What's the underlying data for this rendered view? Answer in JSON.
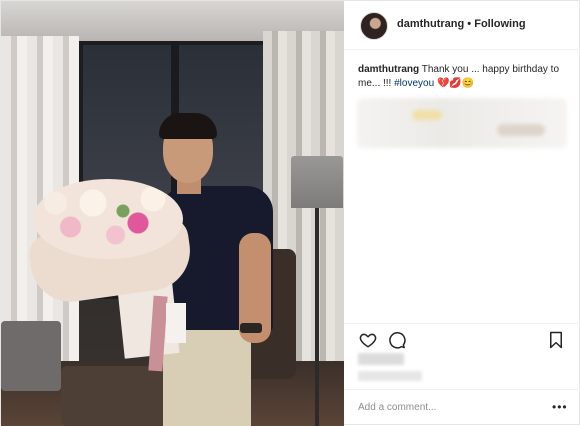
{
  "header": {
    "username": "damthutrang",
    "separator": "•",
    "follow_status": "Following"
  },
  "caption": {
    "username": "damthutrang",
    "text": "Thank you ... happy birthday to me... !!! ",
    "hashtag": "#loveyou",
    "emoji": "💔💋😊"
  },
  "comment_box": {
    "placeholder": "Add a comment..."
  },
  "icons": {
    "like": "heart-icon",
    "comment": "comment-icon",
    "save": "bookmark-icon",
    "more": "more-icon"
  },
  "colors": {
    "text": "#262626",
    "hashtag": "#003569",
    "muted": "#8e8e8e",
    "border": "#efefef"
  }
}
